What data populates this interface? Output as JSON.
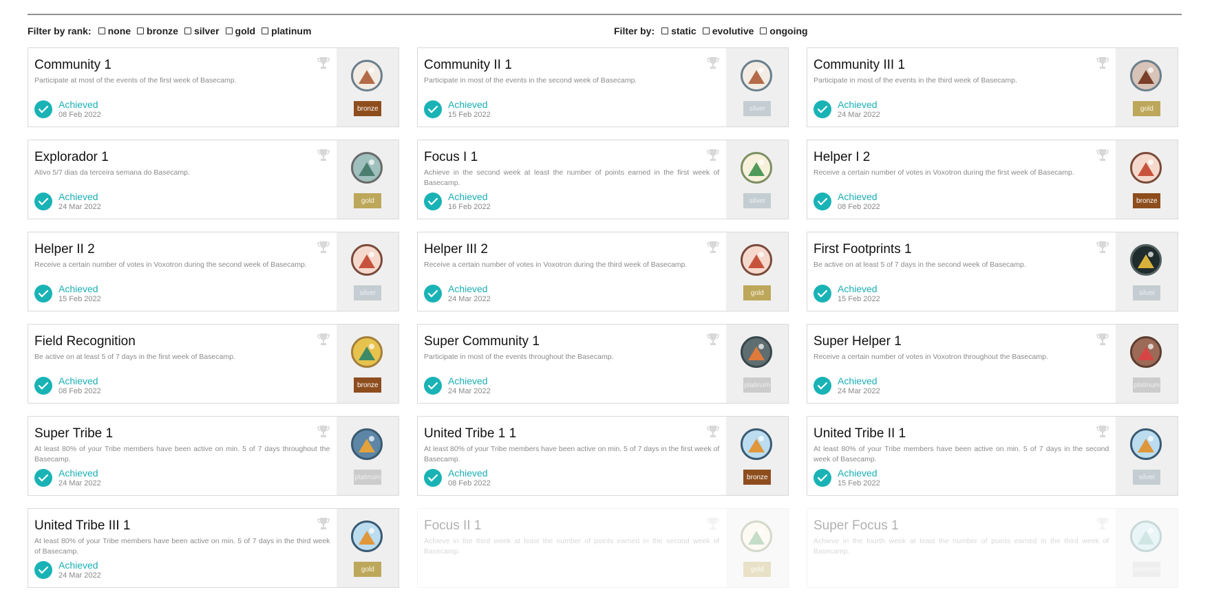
{
  "filters": {
    "rank_label": "Filter by rank:",
    "rank_options": [
      "none",
      "bronze",
      "silver",
      "gold",
      "platinum"
    ],
    "type_label": "Filter by:",
    "type_options": [
      "static",
      "evolutive",
      "ongoing"
    ]
  },
  "cards": [
    {
      "title": "Community 1",
      "description": "Participate at most of the events of the first week of Basecamp.",
      "status": "Achieved",
      "date": "08 Feb 2022",
      "rank": "bronze",
      "icon": "marshmallow-stick-icon",
      "locked": false
    },
    {
      "title": "Community II 1",
      "description": "Participate in most of the events in the second week of Basecamp.",
      "status": "Achieved",
      "date": "15 Feb 2022",
      "rank": "silver",
      "icon": "marshmallow-stick-icon",
      "locked": false
    },
    {
      "title": "Community III 1",
      "description": "Participate in most of the events in the third week of Basecamp.",
      "status": "Achieved",
      "date": "24 Mar 2022",
      "rank": "gold",
      "icon": "roasted-marshmallow-icon",
      "locked": false
    },
    {
      "title": "Explorador 1",
      "description": "Ativo 5/7 dias da terceira semana do Basecamp.",
      "status": "Achieved",
      "date": "24 Mar 2022",
      "rank": "gold",
      "icon": "backpack-icon",
      "locked": false
    },
    {
      "title": "Focus I 1",
      "description": "Achieve in the second week at least the number of points earned in the first week of Basecamp.",
      "status": "Achieved",
      "date": "16 Feb 2022",
      "rank": "silver",
      "icon": "map-pin-icon",
      "locked": false
    },
    {
      "title": "Helper I 2",
      "description": "Receive a certain number of votes in Voxotron during the first week of Basecamp.",
      "status": "Achieved",
      "date": "08 Feb 2022",
      "rank": "bronze",
      "icon": "fire-extinguisher-icon",
      "locked": false
    },
    {
      "title": "Helper II 2",
      "description": "Receive a certain number of votes in Voxotron during the second week of Basecamp.",
      "status": "Achieved",
      "date": "15 Feb 2022",
      "rank": "silver",
      "icon": "fire-extinguisher-icon",
      "locked": false
    },
    {
      "title": "Helper III 2",
      "description": "Receive a certain number of votes in Voxotron during the third week of Basecamp.",
      "status": "Achieved",
      "date": "24 Mar 2022",
      "rank": "gold",
      "icon": "fire-extinguisher-icon",
      "locked": false
    },
    {
      "title": "First Footprints 1",
      "description": "Be active on at least 5 of 7 days in the second week of Basecamp.",
      "status": "Achieved",
      "date": "15 Feb 2022",
      "rank": "silver",
      "icon": "boot-icon",
      "locked": false
    },
    {
      "title": "Field Recognition",
      "description": "Be active on at least 5 of 7 days in the first week of Basecamp.",
      "status": "Achieved",
      "date": "08 Feb 2022",
      "rank": "bronze",
      "icon": "tent-icon",
      "locked": false
    },
    {
      "title": "Super Community 1",
      "description": "Participate in most of the events throughout the Basecamp.",
      "status": "Achieved",
      "date": "24 Mar 2022",
      "rank": "platinum",
      "icon": "campfire-stick-icon",
      "locked": false
    },
    {
      "title": "Super Helper 1",
      "description": "Receive a certain number of votes in Voxotron throughout the Basecamp.",
      "status": "Achieved",
      "date": "24 Mar 2022",
      "rank": "platinum",
      "icon": "first-aid-kit-icon",
      "locked": false
    },
    {
      "title": "Super Tribe 1",
      "description": "At least 80% of your Tribe members have been active on min. 5 of 7 days throughout the Basecamp.",
      "status": "Achieved",
      "date": "24 Mar 2022",
      "rank": "platinum",
      "icon": "mountain-tent-icon",
      "locked": false
    },
    {
      "title": "United Tribe 1 1",
      "description": "At least 80% of your Tribe members have been active on min. 5 of 7 days in the first week of Basecamp.",
      "status": "Achieved",
      "date": "08 Feb 2022",
      "rank": "bronze",
      "icon": "tent-night-icon",
      "locked": false
    },
    {
      "title": "United Tribe II 1",
      "description": "At least 80% of your Tribe members have been active on min. 5 of 7 days in the second week of Basecamp.",
      "status": "Achieved",
      "date": "15 Feb 2022",
      "rank": "silver",
      "icon": "tent-night-icon",
      "locked": false
    },
    {
      "title": "United Tribe III 1",
      "description": "At least 80% of your Tribe members have been active on min. 5 of 7 days in the third week of Basecamp.",
      "status": "Achieved",
      "date": "24 Mar 2022",
      "rank": "gold",
      "icon": "tent-night-icon",
      "locked": false
    },
    {
      "title": "Focus II 1",
      "description": "Achieve in the third week at least the number of points earned in the second week of Basecamp.",
      "status": "",
      "date": "",
      "rank": "gold",
      "icon": "map-pin-icon",
      "locked": true
    },
    {
      "title": "Super Focus 1",
      "description": "Achieve in the fourth week at least the number of points earned in the third week of Basecamp.",
      "status": "",
      "date": "",
      "rank": "platinum",
      "icon": "treasure-map-icon",
      "locked": true
    }
  ],
  "colors": {
    "accent": "#19b3b6",
    "bronze": "#8e4d1d",
    "silver": "#c4cdd1",
    "gold": "#bca75b",
    "platinum": "#cccccc"
  }
}
